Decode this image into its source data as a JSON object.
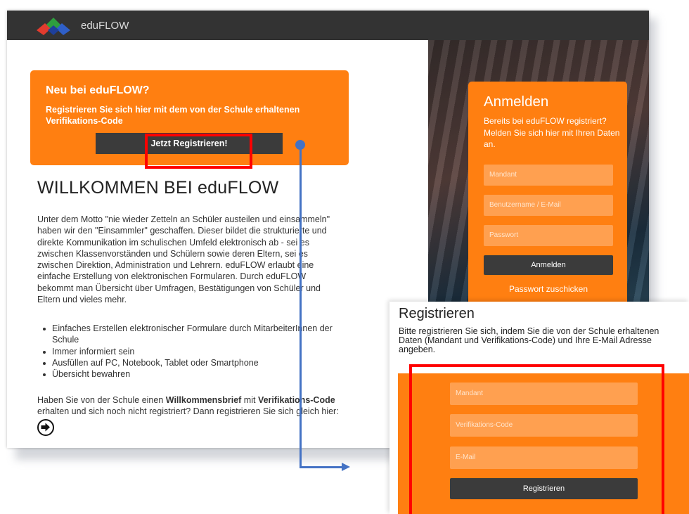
{
  "app": {
    "brand": "eduFLOW"
  },
  "new_panel": {
    "title": "Neu bei eduFLOW?",
    "text": "Registrieren Sie sich hier mit dem von der Schule erhaltenen Verifikations-Code",
    "button_label": "Jetzt Registrieren!"
  },
  "main": {
    "welcome": "WILLKOMMEN BEI eduFLOW",
    "paragraph": "Unter dem Motto \"nie wieder Zetteln an Schüler austeilen und einsammeln\" haben wir den \"Einsammler\" geschaffen. Dieser bildet die strukturierte und direkte Kommunikation im schulischen Umfeld elektronisch ab - sei es zwischen Klassenvorständen und Schülern sowie deren Eltern, sei es zwischen Direktion, Administration und Lehrern. eduFLOW erlaubt eine einfache Erstellung von elektronischen Formularen. Durch eduFLOW bekommt man Übersicht über Umfragen, Bestätigungen von Schüler und Eltern und vieles mehr.",
    "features": [
      "Einfaches Erstellen elektronischer Formulare durch MitarbeiterInnen der Schule",
      "Immer informiert sein",
      "Ausfüllen auf PC, Notebook, Tablet oder Smartphone",
      "Übersicht bewahren"
    ],
    "closing_pre": "Haben Sie von der Schule einen ",
    "closing_bold1": "Willkommensbrief",
    "closing_mid": " mit ",
    "closing_bold2": "Verifikations-Code",
    "closing_post": " erhalten und sich noch nicht registriert? Dann registrieren Sie sich gleich hier:"
  },
  "login": {
    "title": "Anmelden",
    "text": "Bereits bei eduFLOW registriert? Melden Sie sich hier mit Ihren Daten an.",
    "mandant_placeholder": "Mandant",
    "user_placeholder": "Benutzername / E-Mail",
    "password_placeholder": "Passwort",
    "button_label": "Anmelden",
    "forgot_label": "Passwort zuschicken"
  },
  "register": {
    "title": "Registrieren",
    "text": "Bitte registrieren Sie sich, indem Sie die von der Schule erhaltenen Daten (Mandant und Verifikations-Code) und Ihre E-Mail Adresse angeben.",
    "mandant_placeholder": "Mandant",
    "code_placeholder": "Verifikations-Code",
    "email_placeholder": "E-Mail",
    "button_label": "Registrieren"
  },
  "colors": {
    "accent": "#ff7f11",
    "topbar": "#333333",
    "button": "#3b3b3b",
    "highlight": "#ff0000",
    "connector": "#4472c4"
  },
  "icons": {
    "logo": "eduflow-diamond-logo",
    "arrow": "arrow-right-circle-icon"
  }
}
